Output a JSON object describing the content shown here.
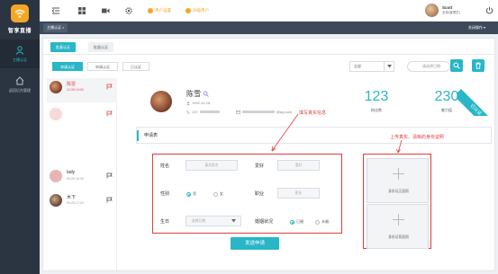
{
  "brand": {
    "logo_text": "智享直播",
    "accent": "#29b6c6",
    "highlight": "#f5a623",
    "annotation_color": "#e23b3b"
  },
  "sidebar": {
    "items": [
      {
        "label": "主播认证",
        "icon": "person-icon",
        "active": true
      },
      {
        "label": "返回后台管理",
        "icon": "home-icon",
        "active": false
      }
    ]
  },
  "topbar": {
    "links": [
      {
        "label": "用户设置"
      },
      {
        "label": "升级用户"
      }
    ],
    "user": {
      "name": "Scott",
      "role": "全部(管理员)"
    }
  },
  "secbar": {
    "crumb": "主播认证 ×",
    "close_label": "关闭操作 ▾"
  },
  "tabs": [
    {
      "label": "批量认证",
      "active": true
    },
    {
      "label": "批量认证",
      "active": false
    }
  ],
  "filters": [
    {
      "label": "申请认证",
      "active": true
    },
    {
      "label": "申请认证",
      "active": false
    },
    {
      "label": "已认证",
      "active": false
    }
  ],
  "select": {
    "value": "全部"
  },
  "search": {
    "placeholder": "请选择日期"
  },
  "list": [
    {
      "name": "陈雷",
      "time": "12-08 19:00",
      "red": true
    },
    {
      "name": "",
      "time": "",
      "red": true
    },
    {
      "name": "lady",
      "time": "09-26 16:30",
      "red": false
    },
    {
      "name": "木下",
      "time": "09-25 17:20",
      "red": false
    }
  ],
  "profile": {
    "name": "陈雪",
    "birth": "1992-11-18",
    "phone_prefix": "137",
    "email_suffix": "@qq.com"
  },
  "stats": [
    {
      "value": "123",
      "label": "粉丝数"
    },
    {
      "value": "230",
      "label": "魅力值"
    }
  ],
  "ribbon": "已认证",
  "form": {
    "title": "申请表",
    "name_label": "姓名",
    "name_placeholder": "真实姓名",
    "hobby_label": "爱好",
    "hobby_placeholder": "爱好",
    "gender_label": "性别",
    "gender_male": "男",
    "gender_female": "女",
    "job_label": "职业",
    "job_placeholder": "职业",
    "birthday_label": "生日",
    "birthday_placeholder": "选择日期",
    "marital_label": "婚姻状况",
    "marital_married": "已婚",
    "marital_single": "未婚",
    "upload_front": "身份证正面照",
    "upload_back": "身份证背面照",
    "submit": "发送申请"
  },
  "annotations": {
    "fill_info": "填写真实信息",
    "upload_id": "上传真实、清晰的身份证照"
  }
}
